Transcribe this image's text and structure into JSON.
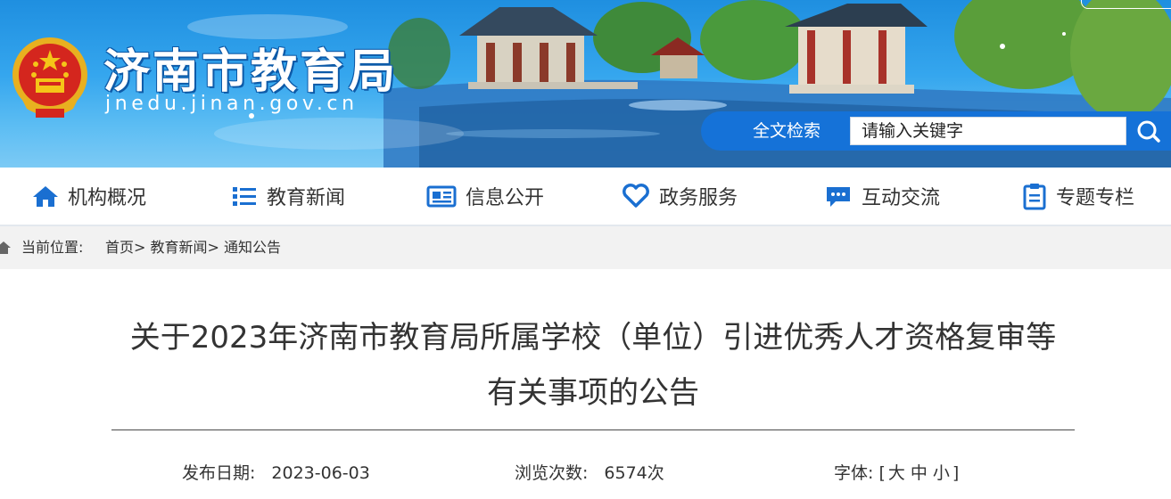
{
  "site": {
    "title": "济南市教育局",
    "domain": "jnedu.jinan.gov.cn"
  },
  "search": {
    "label": "全文检索",
    "placeholder": "请输入关键字"
  },
  "nav": {
    "items": [
      {
        "label": "机构概况",
        "icon": "home-icon"
      },
      {
        "label": "教育新闻",
        "icon": "list-icon"
      },
      {
        "label": "信息公开",
        "icon": "newspaper-icon"
      },
      {
        "label": "政务服务",
        "icon": "heart-icon"
      },
      {
        "label": "互动交流",
        "icon": "chat-icon"
      },
      {
        "label": "专题专栏",
        "icon": "clipboard-icon"
      }
    ]
  },
  "breadcrumb": {
    "prefix": "当前位置:",
    "home": "首页",
    "sep": ">",
    "news": "教育新闻",
    "current": "通知公告"
  },
  "article": {
    "title_line1": "关于2023年济南市教育局所属学校（单位）引进优秀人才资格复审等",
    "title_line2": "有关事项的公告",
    "date_label": "发布日期:",
    "date": "2023-06-03",
    "views_label": "浏览次数:",
    "views": "6574次",
    "font_label": "字体:",
    "font_open": "[",
    "font_large": "大",
    "font_medium": "中",
    "font_small": "小",
    "font_close": "]"
  },
  "colors": {
    "banner_blue": "#1f8fe0",
    "search_blue": "#1572d8",
    "icon_blue": "#1a6fd1",
    "text": "#333333"
  }
}
